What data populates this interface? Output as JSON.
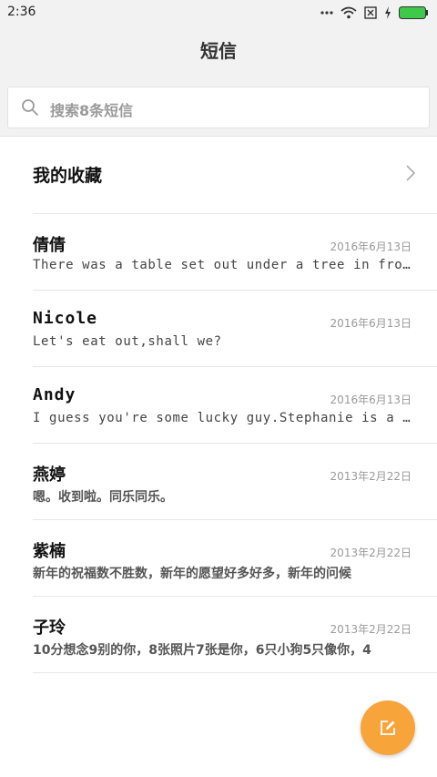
{
  "status_bar": {
    "time": "2:36",
    "icons": [
      "dots-icon",
      "wifi-icon",
      "sim-off-icon",
      "charging-icon",
      "battery-icon"
    ],
    "battery_color": "#3ec94a"
  },
  "header": {
    "title": "短信"
  },
  "search": {
    "placeholder": "搜索8条短信"
  },
  "favorites": {
    "label": "我的收藏"
  },
  "conversations": [
    {
      "name": "倩倩",
      "date": "2016年6月13日",
      "preview": "There was a table set out under a tree in front of the house"
    },
    {
      "name": "Nicole",
      "date": "2016年6月13日",
      "preview": "Let's eat out,shall we?"
    },
    {
      "name": "Andy",
      "date": "2016年6月13日",
      "preview": "I guess you're some lucky guy.Stephanie is a nice girl"
    },
    {
      "name": "燕婷",
      "date": "2013年2月22日",
      "preview": "嗯。收到啦。同乐同乐。"
    },
    {
      "name": "紫楠",
      "date": "2013年2月22日",
      "preview": "新年的祝福数不胜数，新年的愿望好多好多，新年的问候"
    },
    {
      "name": "子玲",
      "date": "2013年2月22日",
      "preview": "10分想念9别的你，8张照片7张是你，6只小狗5只像你，4"
    }
  ],
  "fab": {
    "icon": "compose-icon",
    "color": "#f7a43b"
  }
}
